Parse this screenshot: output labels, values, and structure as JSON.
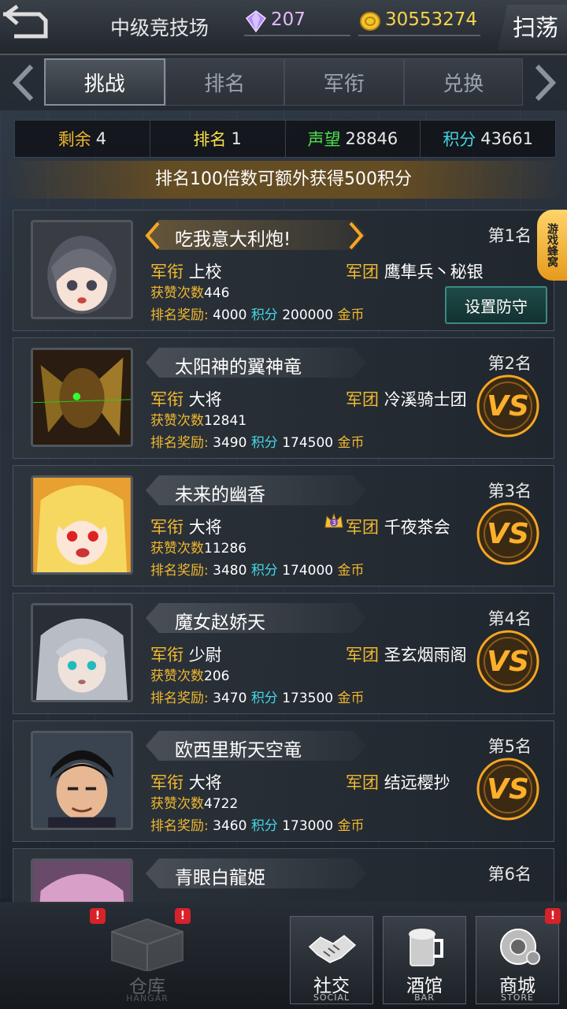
{
  "header": {
    "title": "中级竞技场",
    "gems": "207",
    "gold": "30553274",
    "sweep_label": "扫荡"
  },
  "tabs": [
    {
      "label": "挑战",
      "active": true
    },
    {
      "label": "排名",
      "active": false
    },
    {
      "label": "军衔",
      "active": false
    },
    {
      "label": "兑换",
      "active": false
    }
  ],
  "stats": {
    "remaining_label": "剩余",
    "remaining": "4",
    "rank_label": "排名",
    "rank": "1",
    "prestige_label": "声望",
    "prestige": "28846",
    "points_label": "积分",
    "points": "43661"
  },
  "notice": "排名100倍数可额外获得500积分",
  "side_tag": "游戏蜂窝",
  "labels": {
    "rank_title": "军衔",
    "legion": "军团",
    "likes": "获赞次数",
    "reward": "排名奖励:",
    "points_unit": "积分",
    "gold_unit": "金币",
    "set_defense": "设置防守"
  },
  "players": [
    {
      "name": "吃我意大利炮!",
      "rank": "第1名",
      "title": "上校",
      "legion": "鹰隼兵丶秘银",
      "likes": "446",
      "reward_points": "4000",
      "reward_gold": "200000"
    },
    {
      "name": "太阳神的翼神竜",
      "rank": "第2名",
      "title": "大将",
      "legion": "冷溪骑士团",
      "likes": "12841",
      "reward_points": "3490",
      "reward_gold": "174500"
    },
    {
      "name": "未来的幽香",
      "rank": "第3名",
      "title": "大将",
      "legion": "千夜茶会",
      "likes": "11286",
      "reward_points": "3480",
      "reward_gold": "174000",
      "crown": "3"
    },
    {
      "name": "魔女赵娇天",
      "rank": "第4名",
      "title": "少尉",
      "legion": "圣玄烟雨阁",
      "likes": "206",
      "reward_points": "3470",
      "reward_gold": "173500"
    },
    {
      "name": "欧西里斯天空竜",
      "rank": "第5名",
      "title": "大将",
      "legion": "结远樱抄",
      "likes": "4722",
      "reward_points": "3460",
      "reward_gold": "173000"
    },
    {
      "name": "青眼白龍姫",
      "rank": "第6名"
    }
  ],
  "bottom_nav": {
    "hangar": {
      "cn": "仓库",
      "en": "HANGAR"
    },
    "social": {
      "cn": "社交",
      "en": "SOCIAL"
    },
    "bar": {
      "cn": "酒馆",
      "en": "BAR"
    },
    "store": {
      "cn": "商城",
      "en": "STORE"
    }
  },
  "colors": {
    "gold": "#f0b830",
    "cyan": "#45d6e6",
    "accent_orange": "#f5a623"
  }
}
